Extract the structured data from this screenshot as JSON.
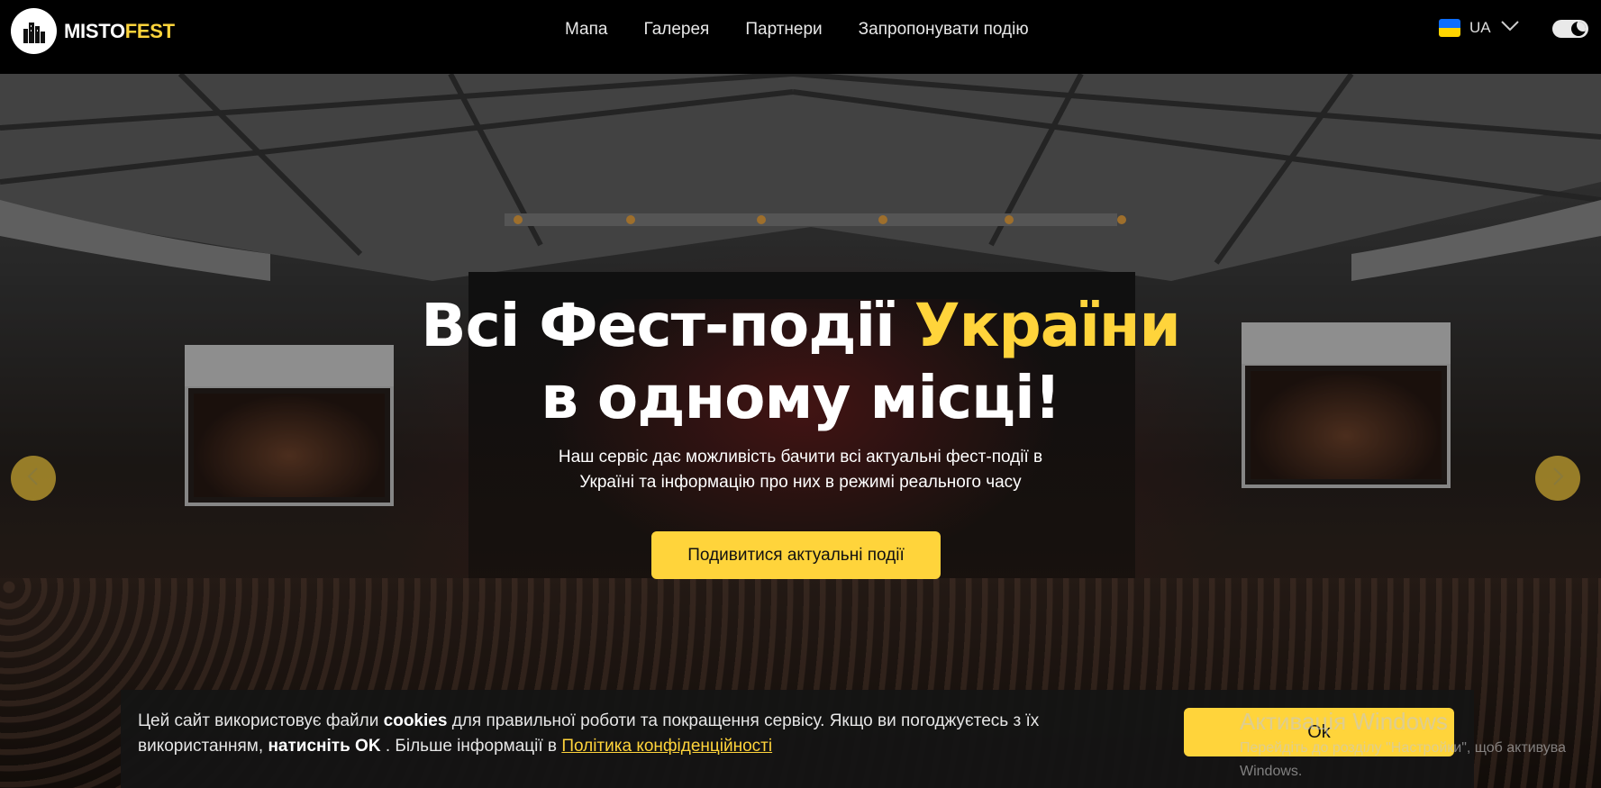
{
  "header": {
    "logo": {
      "part1": "MISTO",
      "part2": "FEST"
    },
    "nav": [
      {
        "label": "Мапа"
      },
      {
        "label": "Галерея"
      },
      {
        "label": "Партнери"
      },
      {
        "label": "Запропонувати подію"
      }
    ],
    "language": {
      "label": "UA",
      "flag": "ukraine-flag"
    },
    "theme_toggle": {
      "icon": "moon-icon"
    }
  },
  "hero": {
    "title_part1": "Всі Фест-події ",
    "title_accent": "України",
    "title_line2": "в одному місці!",
    "subtitle_line1": "Наш сервіс дає можливість бачити всі актуальні фест-події в",
    "subtitle_line2": "Україні та інформацію про них в режимі реального часу",
    "cta_label": "Подивитися актуальні події",
    "prev_icon": "chevron-left-icon",
    "next_icon": "chevron-right-icon"
  },
  "cookie": {
    "text_1": "Цей сайт використовує файли ",
    "text_bold1": "cookies",
    "text_2": " для правильної роботи та покращення сервісу. Якщо ви погоджуєтесь з їх використанням, ",
    "text_bold2": "натисніть OK",
    "text_3": " . Більше інформації в ",
    "link": "Політика конфіденційності",
    "ok_label": "Ok"
  },
  "watermark": {
    "title": "Активація Windows",
    "sub1": "Перейдіть до розділу \"Настройки\", щоб активува",
    "sub2": "Windows."
  },
  "colors": {
    "accent": "#ffd43b",
    "header_bg": "#000000"
  }
}
